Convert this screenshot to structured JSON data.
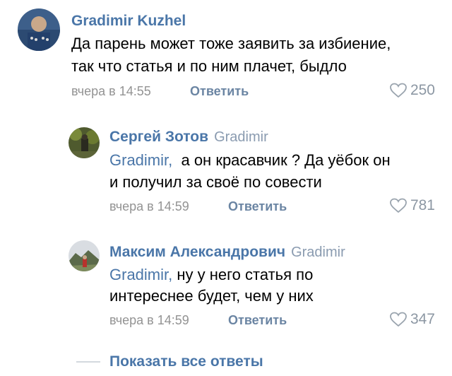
{
  "comments": [
    {
      "author": "Gradimir Kuzhel",
      "reply_to": "",
      "lines": [
        "Да парень может тоже заявить за избиение,",
        "так что статья и по ним плачет, быдло"
      ],
      "mention": "",
      "time": "вчера в 14:55",
      "reply_label": "Ответить",
      "likes": "250"
    },
    {
      "author": "Сергей Зотов",
      "reply_to": "Gradimir",
      "mention": "Gradimir,",
      "line1_rest": "  а он красавчик ? Да уёбок он",
      "line2": "и получил за своё по совести",
      "time": "вчера в 14:59",
      "reply_label": "Ответить",
      "likes": "781"
    },
    {
      "author": "Максим Александрович",
      "reply_to": "Gradimir",
      "mention": "Gradimir,",
      "line1_rest": " ну у него статья по",
      "line2": "интереснее будет, чем у них",
      "time": "вчера в 14:59",
      "reply_label": "Ответить",
      "likes": "347"
    }
  ],
  "show_all_label": "Показать все ответы",
  "colors": {
    "link": "#4a76a8",
    "meta": "#939393",
    "reply": "#6b85a3"
  },
  "icons": {
    "like": "heart-outline-icon"
  }
}
